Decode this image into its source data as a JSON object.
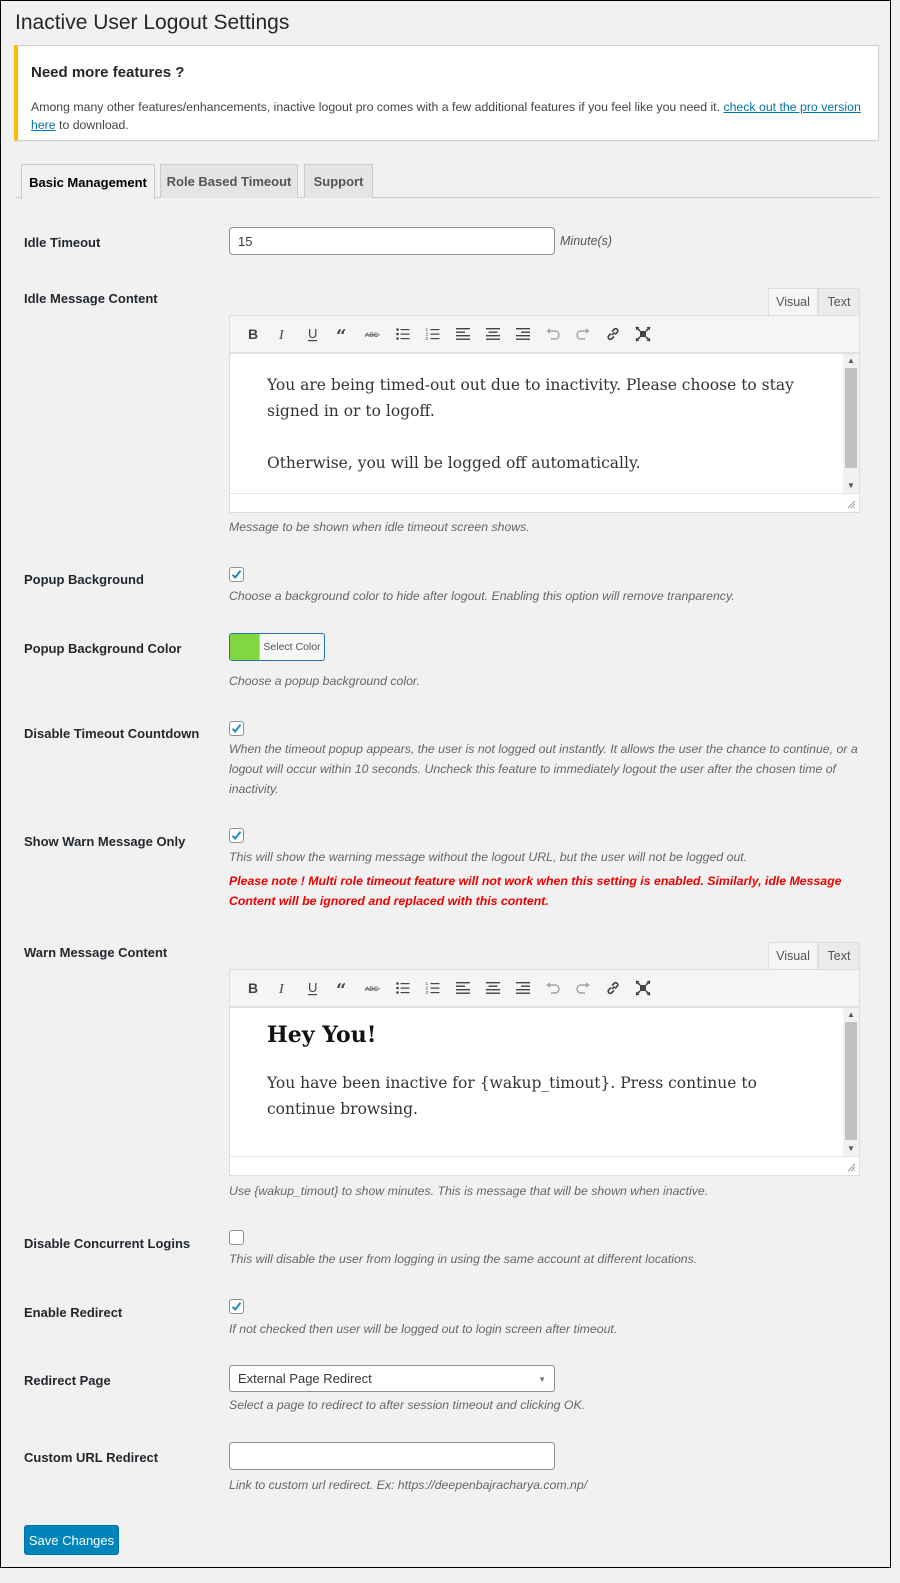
{
  "page": {
    "title": "Inactive User Logout Settings"
  },
  "notice": {
    "heading": "Need more features ?",
    "text": "Among many other features/enhancements, inactive logout pro comes with a few additional features if you feel like you need it. ",
    "link_text": "check out the pro version here",
    "text_after": " to download.",
    "accent_color": "#ffb900"
  },
  "tabs": [
    {
      "label": "Basic Management",
      "active": true
    },
    {
      "label": "Role Based Timeout",
      "active": false
    },
    {
      "label": "Support",
      "active": false
    }
  ],
  "fields": {
    "idle_timeout": {
      "label": "Idle Timeout",
      "value": "15",
      "unit": "Minute(s)"
    },
    "idle_message": {
      "label": "Idle Message Content",
      "editor_tabs": {
        "visual": "Visual",
        "text": "Text"
      },
      "paragraphs": [
        "You are being timed-out out due to inactivity. Please choose to stay signed in or to logoff.",
        "Otherwise, you will be logged off automatically."
      ],
      "description": "Message to be shown when idle timeout screen shows."
    },
    "popup_background": {
      "label": "Popup Background",
      "checked": true,
      "description": "Choose a background color to hide after logout. Enabling this option will remove tranparency."
    },
    "popup_background_color": {
      "label": "Popup Background Color",
      "button_label": "Select Color",
      "color": "#81d742",
      "description": "Choose a popup background color."
    },
    "disable_timeout_countdown": {
      "label": "Disable Timeout Countdown",
      "checked": true,
      "description": "When the timeout popup appears, the user is not logged out instantly. It allows the user the chance to continue, or a logout will occur within 10 seconds. Uncheck this feature to immediately logout the user after the chosen time of inactivity."
    },
    "show_warn_message_only": {
      "label": "Show Warn Message Only",
      "checked": true,
      "description": "This will show the warning message without the logout URL, but the user will not be logged out.",
      "warning": "Please note ! Multi role timeout feature will not work when this setting is enabled. Similarly, idle Message Content will be ignored and replaced with this content.",
      "warning_color": "#ee0000"
    },
    "warn_message": {
      "label": "Warn Message Content",
      "editor_tabs": {
        "visual": "Visual",
        "text": "Text"
      },
      "heading": "Hey You!",
      "paragraphs": [
        "You have been inactive for {wakup_timout}. Press continue to continue browsing."
      ],
      "description": "Use {wakup_timout} to show minutes. This is message that will be shown when inactive."
    },
    "disable_concurrent_logins": {
      "label": "Disable Concurrent Logins",
      "checked": false,
      "description": "This will disable the user from logging in using the same account at different locations."
    },
    "enable_redirect": {
      "label": "Enable Redirect",
      "checked": true,
      "description": "If not checked then user will be logged out to login screen after timeout."
    },
    "redirect_page": {
      "label": "Redirect Page",
      "selected": "External Page Redirect",
      "description": "Select a page to redirect to after session timeout and clicking OK."
    },
    "custom_url_redirect": {
      "label": "Custom URL Redirect",
      "value": "",
      "placeholder": "",
      "description": "Link to custom url redirect. Ex: https://deepenbajracharya.com.np/"
    }
  },
  "toolbar_icons": [
    "bold-icon",
    "italic-icon",
    "underline-icon",
    "blockquote-icon",
    "strikethrough-icon",
    "bullet-list-icon",
    "numbered-list-icon",
    "align-left-icon",
    "align-center-icon",
    "align-right-icon",
    "undo-icon",
    "redo-icon",
    "link-icon",
    "fullscreen-icon"
  ],
  "actions": {
    "save_label": "Save Changes",
    "primary_color": "#0085ba"
  }
}
